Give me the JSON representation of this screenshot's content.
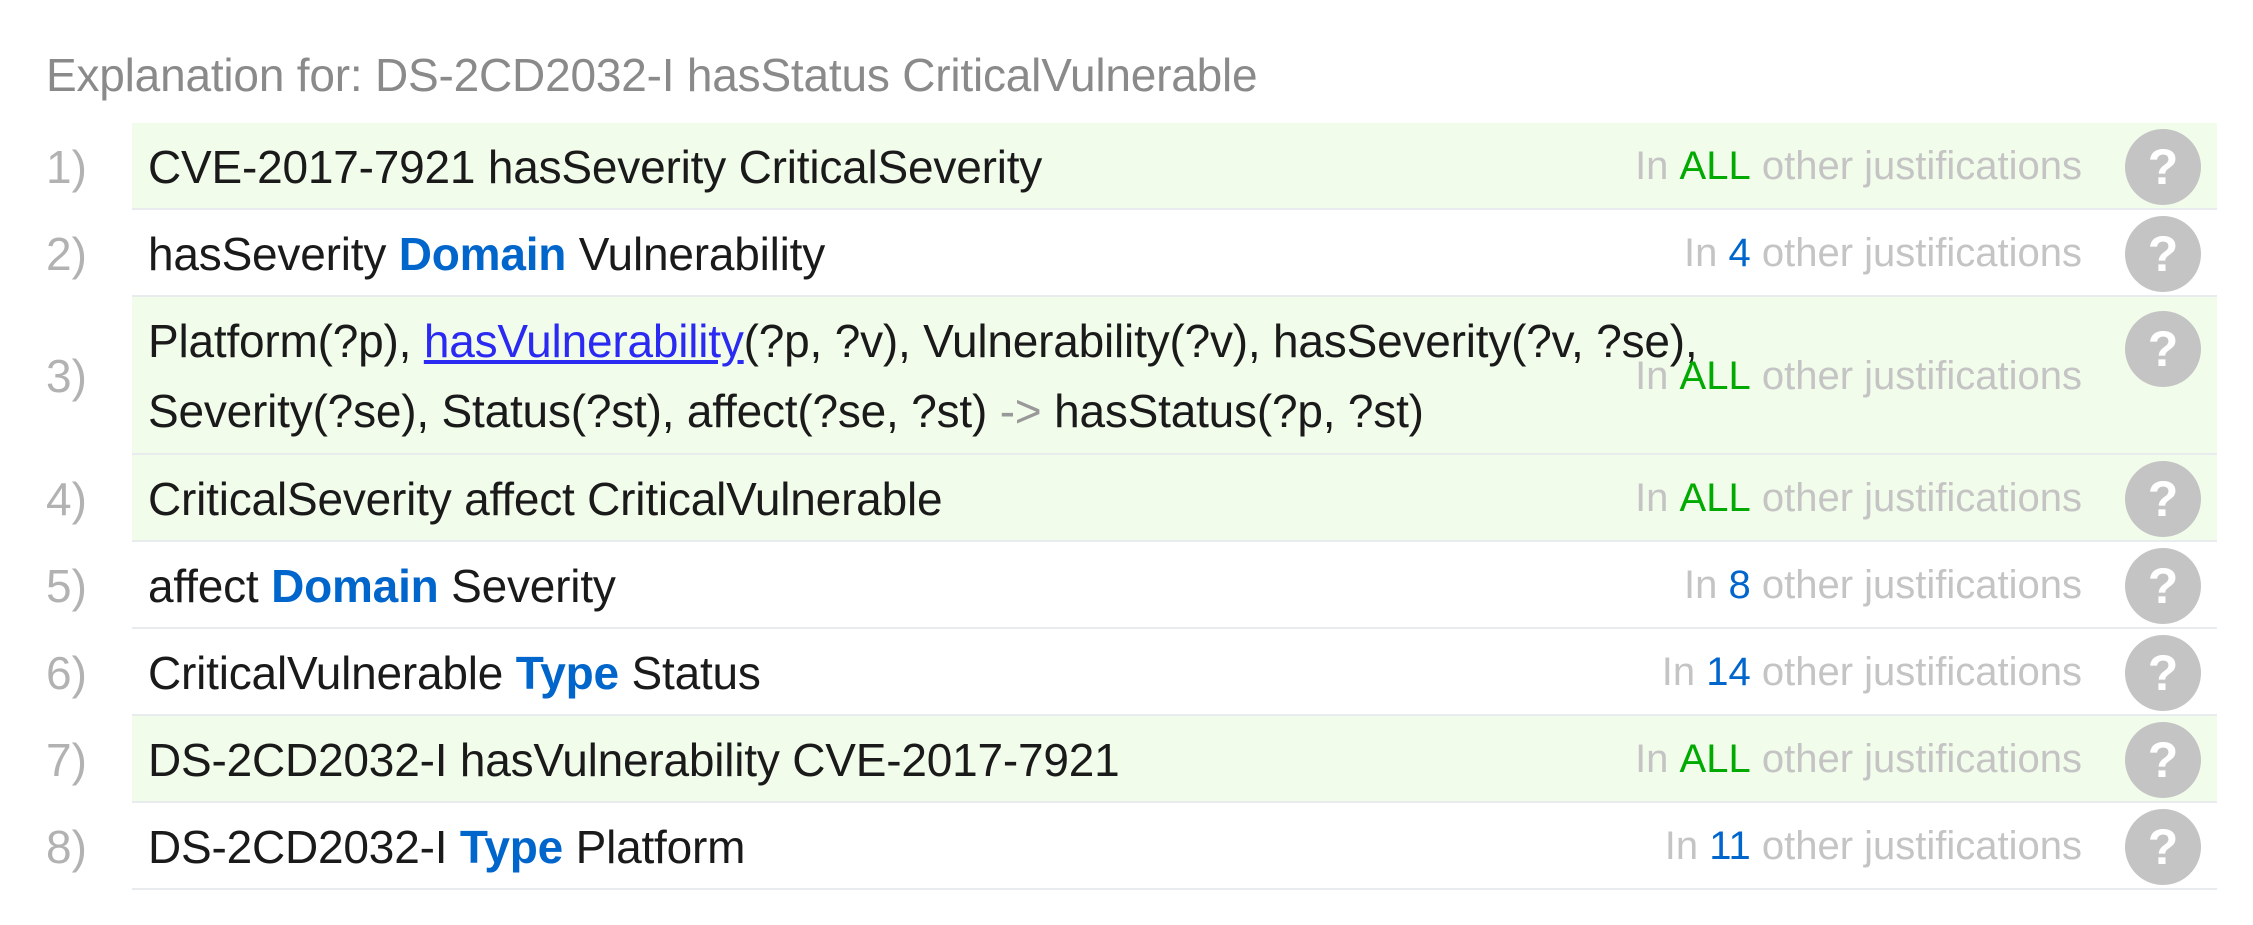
{
  "header": {
    "title": "Explanation for: DS-2CD2032-I hasStatus CriticalVulnerable"
  },
  "justification_text": {
    "prefix": "In",
    "suffix": "other justifications"
  },
  "help_icon_glyph": "?",
  "colors": {
    "highlight_row": "#f2fceb",
    "keyword": "#0066cc",
    "all_count": "#00aa00",
    "muted": "#c4c4c4"
  },
  "rows": [
    {
      "num": "1)",
      "highlighted": true,
      "parts": [
        "CVE-2017-7921 hasSeverity CriticalSeverity"
      ],
      "count": "ALL"
    },
    {
      "num": "2)",
      "highlighted": false,
      "parts": [
        "hasSeverity ",
        "Domain",
        " Vulnerability"
      ],
      "count": "4"
    },
    {
      "num": "3)",
      "highlighted": true,
      "line1": [
        "Platform(?p), ",
        "hasVulnerability",
        "(?p, ?v), Vulnerability(?v), hasSeverity(?v, ?se),"
      ],
      "line2": [
        "Severity(?se), Status(?st), affect(?se, ?st) ",
        "->",
        " hasStatus(?p, ?st)"
      ],
      "count": "ALL"
    },
    {
      "num": "4)",
      "highlighted": true,
      "parts": [
        "CriticalSeverity affect CriticalVulnerable"
      ],
      "count": "ALL"
    },
    {
      "num": "5)",
      "highlighted": false,
      "parts": [
        "affect ",
        "Domain",
        " Severity"
      ],
      "count": "8"
    },
    {
      "num": "6)",
      "highlighted": false,
      "parts": [
        "CriticalVulnerable ",
        "Type",
        " Status"
      ],
      "count": "14"
    },
    {
      "num": "7)",
      "highlighted": true,
      "parts": [
        "DS-2CD2032-I hasVulnerability CVE-2017-7921"
      ],
      "count": "ALL"
    },
    {
      "num": "8)",
      "highlighted": false,
      "parts": [
        "DS-2CD2032-I ",
        "Type",
        " Platform"
      ],
      "count": "11"
    }
  ]
}
